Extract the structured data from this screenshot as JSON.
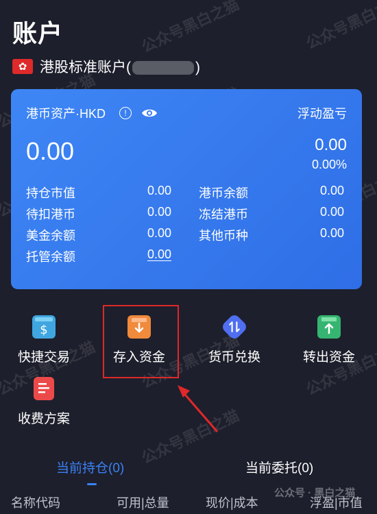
{
  "header": {
    "title": "账户"
  },
  "account": {
    "name_prefix": "港股标准账户(",
    "name_suffix": ")"
  },
  "card": {
    "asset_label": "港币资产·HKD",
    "float_label": "浮动盈亏",
    "asset_value": "0.00",
    "float_value": "0.00",
    "float_pct": "0.00%",
    "rows": [
      {
        "label": "持仓市值",
        "value": "0.00"
      },
      {
        "label": "港币余额",
        "value": "0.00"
      },
      {
        "label": "待扣港币",
        "value": "0.00"
      },
      {
        "label": "冻结港币",
        "value": "0.00"
      },
      {
        "label": "美金余额",
        "value": "0.00"
      },
      {
        "label": "其他币种",
        "value": "0.00"
      },
      {
        "label": "托管余额",
        "value": "0.00"
      }
    ]
  },
  "actions": {
    "quick_trade": "快捷交易",
    "deposit": "存入资金",
    "fx": "货币兑换",
    "withdraw": "转出资金",
    "fees": "收费方案"
  },
  "tabs": {
    "positions": "当前持仓(0)",
    "orders": "当前委托(0)"
  },
  "columns": [
    "名称代码",
    "可用|总量",
    "现价|成本",
    "浮盈|市值"
  ],
  "watermarks": [
    "公众号黑白之猫",
    "公众号 · 黑白之猫"
  ],
  "colors": {
    "accent": "#3b82f6",
    "card": "#3a80f2",
    "highlight": "#e0282a",
    "bg": "#1d1f2c"
  },
  "icons": [
    "hk-flag-icon",
    "info-icon",
    "eye-icon",
    "dollar-bag-icon",
    "download-box-icon",
    "currency-exchange-icon",
    "upload-icon",
    "fee-document-icon"
  ]
}
